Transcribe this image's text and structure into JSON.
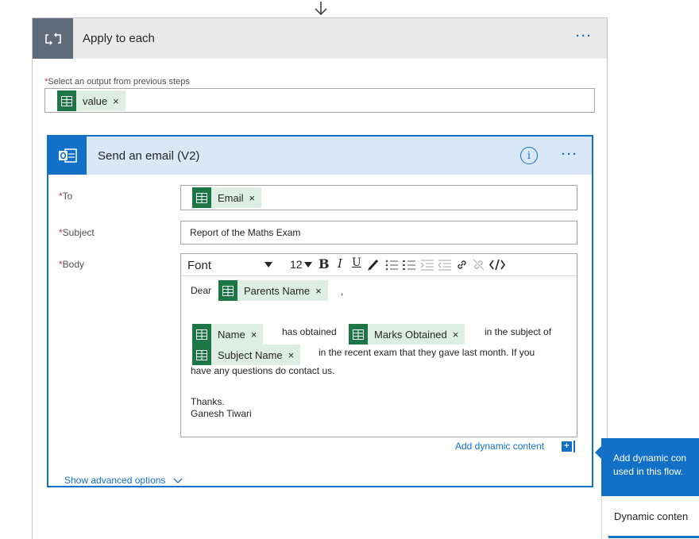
{
  "apply_to_each": {
    "title": "Apply to each",
    "menu": "···",
    "select_label": "Select an output from previous steps",
    "required_mark": "*",
    "value_token": "value"
  },
  "send_email": {
    "title": "Send an email (V2)",
    "menu": "···",
    "info": "i",
    "to_label": "To",
    "to_token": "Email",
    "subject_label": "Subject",
    "subject_value": "Report of the Maths Exam",
    "body_label": "Body",
    "toolbar": {
      "font": "Font",
      "size": "12",
      "bold": "B",
      "italic": "I",
      "underline": "U"
    },
    "body": {
      "dear": "Dear",
      "parents_token": "Parents Name",
      "comma": ",",
      "name_token": "Name",
      "has_obtained": "has obtained",
      "marks_token": "Marks Obtained",
      "in_subject_of": "in the subject of",
      "subject_token": "Subject Name",
      "recent_exam": "in the recent exam that they gave last month. If you",
      "questions": "have any questions do contact us.",
      "thanks": "Thanks.",
      "signature": "Ganesh Tiwari"
    },
    "add_dynamic": "Add dynamic content",
    "advanced": "Show advanced options"
  },
  "side_panel": {
    "line1": "Add dynamic con",
    "line2": "used in this flow.",
    "tab": "Dynamic conten"
  },
  "remove_glyph": "×",
  "colors": {
    "accent": "#1271c7",
    "excel_green": "#1d7745",
    "token_bg": "#dfeee4",
    "loop_header": "#5f6b7a"
  }
}
